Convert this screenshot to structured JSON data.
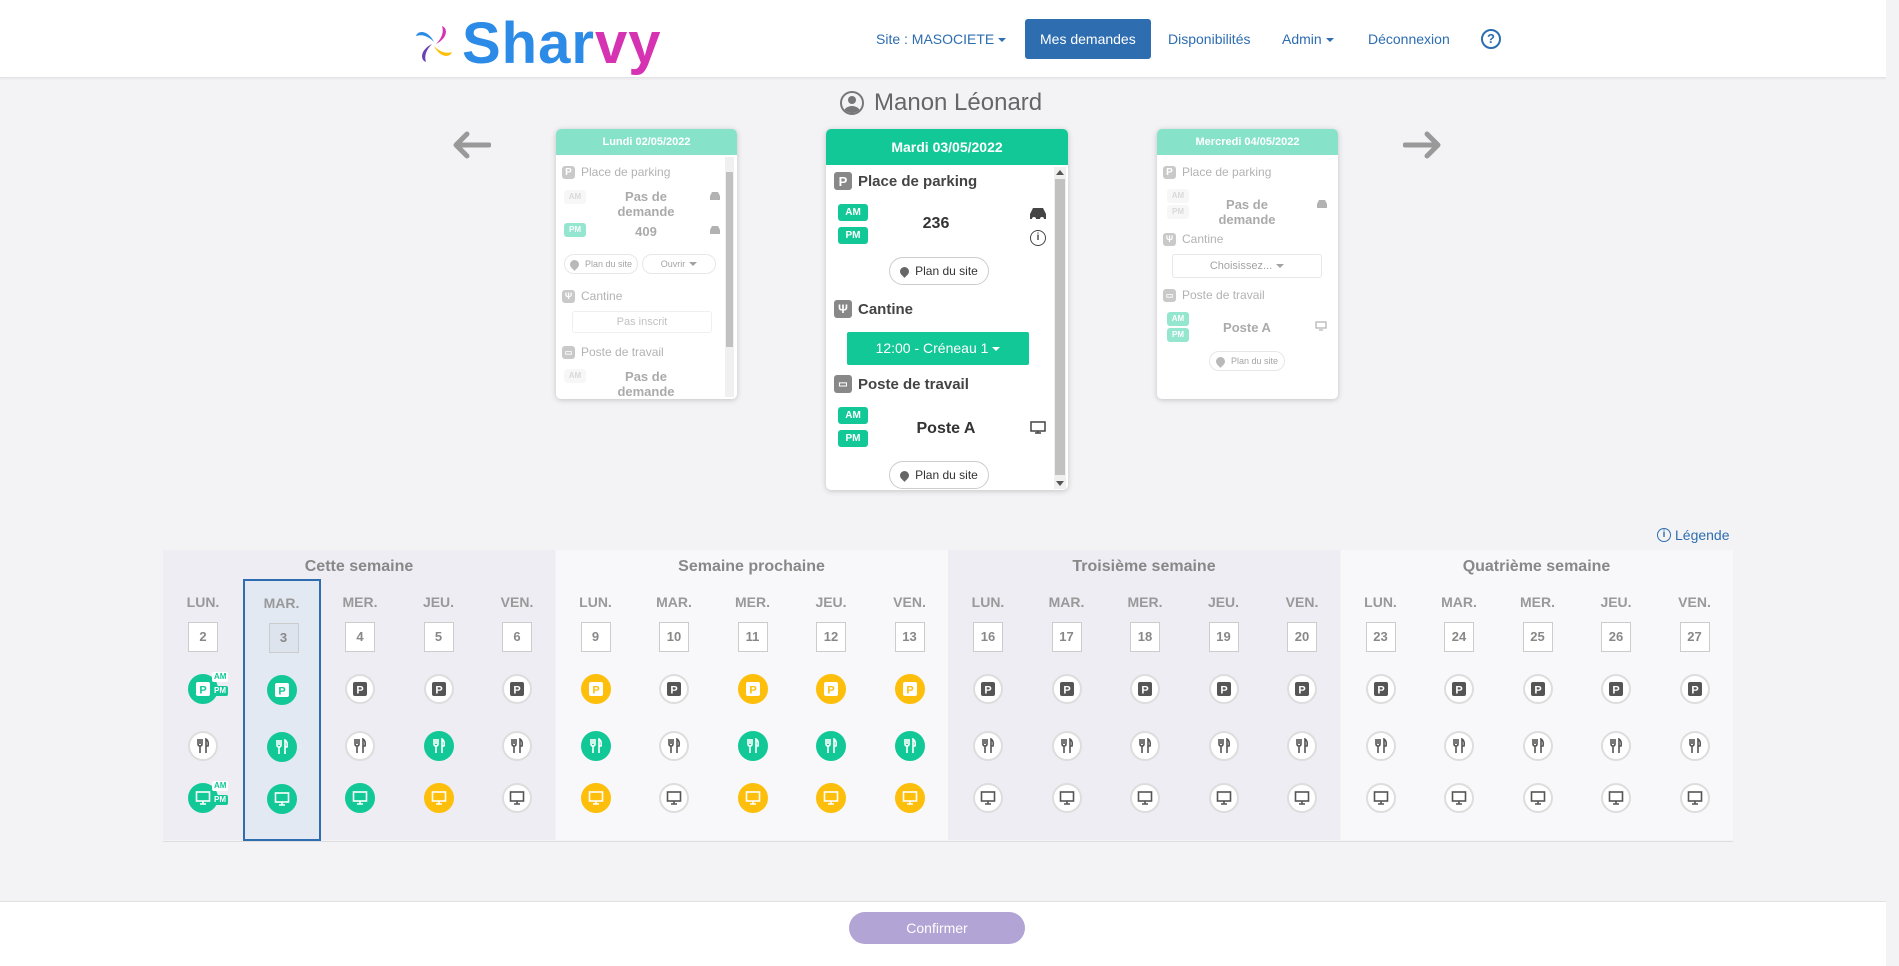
{
  "header": {
    "logo_text_1": "Shar",
    "logo_text_2": "vy",
    "nav": {
      "site": "Site : MASOCIETE",
      "requests": "Mes demandes",
      "availability": "Disponibilités",
      "admin": "Admin",
      "logout": "Déconnexion",
      "help": "?"
    }
  },
  "user": {
    "name": "Manon Léonard"
  },
  "cards": {
    "prev": {
      "title": "Lundi 02/05/2022",
      "parking_label": "Place de parking",
      "am": "AM",
      "pm": "PM",
      "am_value": "Pas de demande",
      "pm_value": "409",
      "plan": "Plan du site",
      "open": "Ouvrir",
      "canteen_label": "Cantine",
      "canteen_value": "Pas inscrit",
      "desk_label": "Poste de travail",
      "desk_value": "Pas de demande"
    },
    "current": {
      "title": "Mardi 03/05/2022",
      "parking_label": "Place de parking",
      "am": "AM",
      "pm": "PM",
      "parking_value": "236",
      "plan": "Plan du site",
      "canteen_label": "Cantine",
      "canteen_slot": "12:00 - Créneau 1",
      "desk_label": "Poste de travail",
      "desk_value": "Poste A",
      "plan2": "Plan du site"
    },
    "next": {
      "title": "Mercredi 04/05/2022",
      "parking_label": "Place de parking",
      "am": "AM",
      "pm": "PM",
      "parking_value": "Pas de demande",
      "canteen_label": "Cantine",
      "canteen_select": "Choisissez...",
      "desk_label": "Poste de travail",
      "desk_value": "Poste A",
      "plan": "Plan du site"
    }
  },
  "legend": "Légende",
  "weeks": [
    {
      "title": "Cette semaine",
      "days": [
        {
          "dow": "LUN.",
          "num": "2",
          "p": "g",
          "c": "n",
          "d": "g",
          "split": true
        },
        {
          "dow": "MAR.",
          "num": "3",
          "p": "g",
          "c": "g",
          "d": "g",
          "selected": true
        },
        {
          "dow": "MER.",
          "num": "4",
          "p": "n",
          "c": "n",
          "d": "g"
        },
        {
          "dow": "JEU.",
          "num": "5",
          "p": "n",
          "c": "g",
          "d": "y"
        },
        {
          "dow": "VEN.",
          "num": "6",
          "p": "n",
          "c": "n",
          "d": "n"
        }
      ]
    },
    {
      "title": "Semaine prochaine",
      "days": [
        {
          "dow": "LUN.",
          "num": "9",
          "p": "y",
          "c": "g",
          "d": "y"
        },
        {
          "dow": "MAR.",
          "num": "10",
          "p": "n",
          "c": "n",
          "d": "n"
        },
        {
          "dow": "MER.",
          "num": "11",
          "p": "y",
          "c": "g",
          "d": "y"
        },
        {
          "dow": "JEU.",
          "num": "12",
          "p": "y",
          "c": "g",
          "d": "y"
        },
        {
          "dow": "VEN.",
          "num": "13",
          "p": "y",
          "c": "g",
          "d": "y"
        }
      ]
    },
    {
      "title": "Troisième semaine",
      "days": [
        {
          "dow": "LUN.",
          "num": "16",
          "p": "n",
          "c": "n",
          "d": "n"
        },
        {
          "dow": "MAR.",
          "num": "17",
          "p": "n",
          "c": "n",
          "d": "n"
        },
        {
          "dow": "MER.",
          "num": "18",
          "p": "n",
          "c": "n",
          "d": "n"
        },
        {
          "dow": "JEU.",
          "num": "19",
          "p": "n",
          "c": "n",
          "d": "n"
        },
        {
          "dow": "VEN.",
          "num": "20",
          "p": "n",
          "c": "n",
          "d": "n"
        }
      ]
    },
    {
      "title": "Quatrième semaine",
      "days": [
        {
          "dow": "LUN.",
          "num": "23",
          "p": "n",
          "c": "n",
          "d": "n"
        },
        {
          "dow": "MAR.",
          "num": "24",
          "p": "n",
          "c": "n",
          "d": "n"
        },
        {
          "dow": "MER.",
          "num": "25",
          "p": "n",
          "c": "n",
          "d": "n"
        },
        {
          "dow": "JEU.",
          "num": "26",
          "p": "n",
          "c": "n",
          "d": "n"
        },
        {
          "dow": "VEN.",
          "num": "27",
          "p": "n",
          "c": "n",
          "d": "n"
        }
      ]
    }
  ],
  "footer": {
    "confirm": "Confirmer"
  },
  "colors": {
    "brand_blue": "#2d6db0",
    "green": "#13c897",
    "yellow": "#fdbf0b",
    "confirm": "#b2a4d4"
  }
}
